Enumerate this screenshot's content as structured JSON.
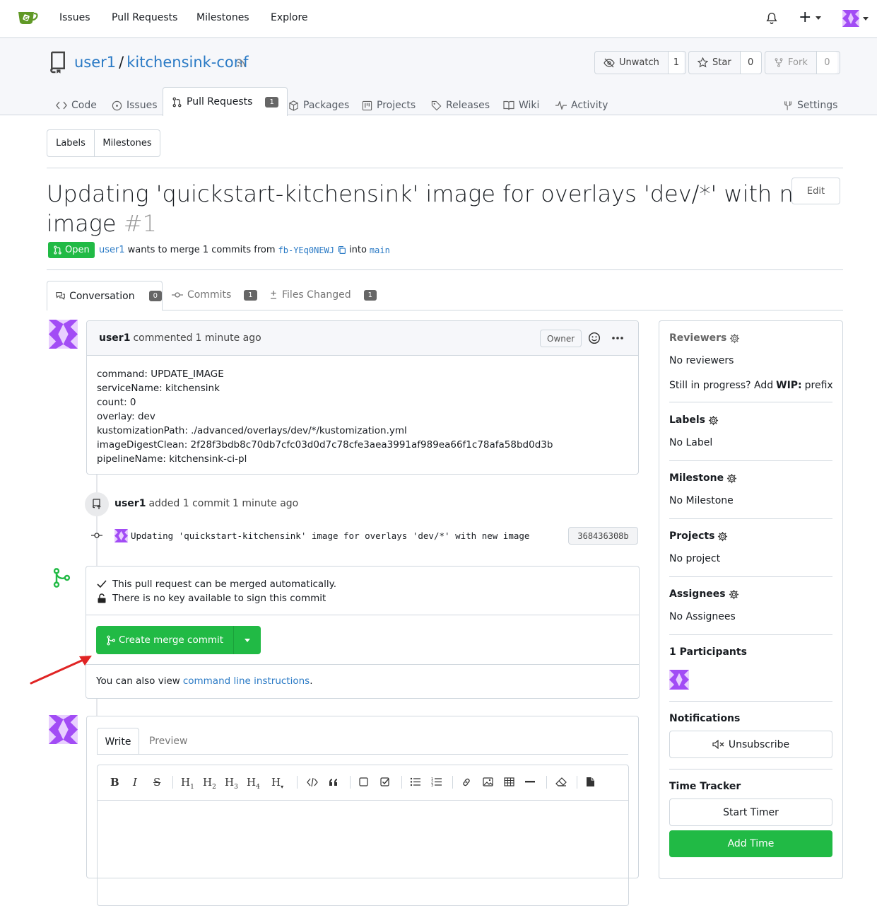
{
  "nav": {
    "items": [
      "Issues",
      "Pull Requests",
      "Milestones",
      "Explore"
    ],
    "plus_label": "+"
  },
  "repo": {
    "owner": "user1",
    "separator": "/",
    "name": "kitchensink-conf",
    "unwatch_label": "Unwatch",
    "watch_count": "1",
    "star_label": "Star",
    "star_count": "0",
    "fork_label": "Fork",
    "fork_count": "0"
  },
  "tabs": {
    "code": "Code",
    "issues": "Issues",
    "pulls": "Pull Requests",
    "pulls_count": "1",
    "packages": "Packages",
    "projects": "Projects",
    "releases": "Releases",
    "wiki": "Wiki",
    "activity": "Activity",
    "settings": "Settings"
  },
  "filters": {
    "labels": "Labels",
    "milestones": "Milestones"
  },
  "pr": {
    "title_line1": "Updating 'quickstart-kitchensink' image for overlays 'dev/*' with new",
    "title_line2": "image",
    "number": "#1",
    "edit_label": "Edit",
    "state": "Open",
    "author": "user1",
    "merge_text": "wants to merge 1 commits from",
    "head_branch": "fb-YEq0NEWJ",
    "into_text": "into",
    "base_branch": "main"
  },
  "pr_tabs": {
    "conversation": "Conversation",
    "conversation_count": "0",
    "commits": "Commits",
    "commits_count": "1",
    "files": "Files Changed",
    "files_count": "1"
  },
  "comment": {
    "author": "user1",
    "action": "commented",
    "time": "1 minute ago",
    "role": "Owner",
    "lines": [
      "command: UPDATE_IMAGE",
      "serviceName: kitchensink",
      "count: 0",
      "overlay: dev",
      "kustomizationPath: ./advanced/overlays/dev/*/kustomization.yml",
      "imageDigestClean: 2f28f3bdb8c70db7cfc03d0d7c78cfe3aea3991af989ea66f1c78afa58bd0d3b",
      "pipelineName: kitchensink-ci-pl"
    ]
  },
  "commit_event": {
    "author": "user1",
    "text": "added 1 commit",
    "time": "1 minute ago",
    "message": "Updating 'quickstart-kitchensink' image for overlays 'dev/*' with new image",
    "sha": "368436308b"
  },
  "merge": {
    "auto_text": "This pull request can be merged automatically.",
    "sign_text": "There is no key available to sign this commit",
    "button_label": "Create merge commit",
    "also_view_text": "You can also view",
    "cli_link": "command line instructions",
    "period": "."
  },
  "editor": {
    "write_tab": "Write",
    "preview_tab": "Preview"
  },
  "sidebar": {
    "reviewers_title": "Reviewers",
    "reviewers_value": "No reviewers",
    "wip_prefix_text": "Still in progress? Add",
    "wip_keyword": "WIP:",
    "wip_suffix": "prefix",
    "labels_title": "Labels",
    "labels_value": "No Label",
    "milestone_title": "Milestone",
    "milestone_value": "No Milestone",
    "projects_title": "Projects",
    "projects_value": "No project",
    "assignees_title": "Assignees",
    "assignees_value": "No Assignees",
    "participants_title": "1 Participants",
    "notifications_title": "Notifications",
    "unsubscribe_label": "Unsubscribe",
    "time_tracker_title": "Time Tracker",
    "start_timer_label": "Start Timer",
    "add_time_label": "Add Time"
  },
  "colors": {
    "accent": "#2a7ac5",
    "green": "#21ba45",
    "open_green": "#21ba45",
    "avatar_purple": "#a24cf5",
    "arrow_red": "#e02424"
  }
}
